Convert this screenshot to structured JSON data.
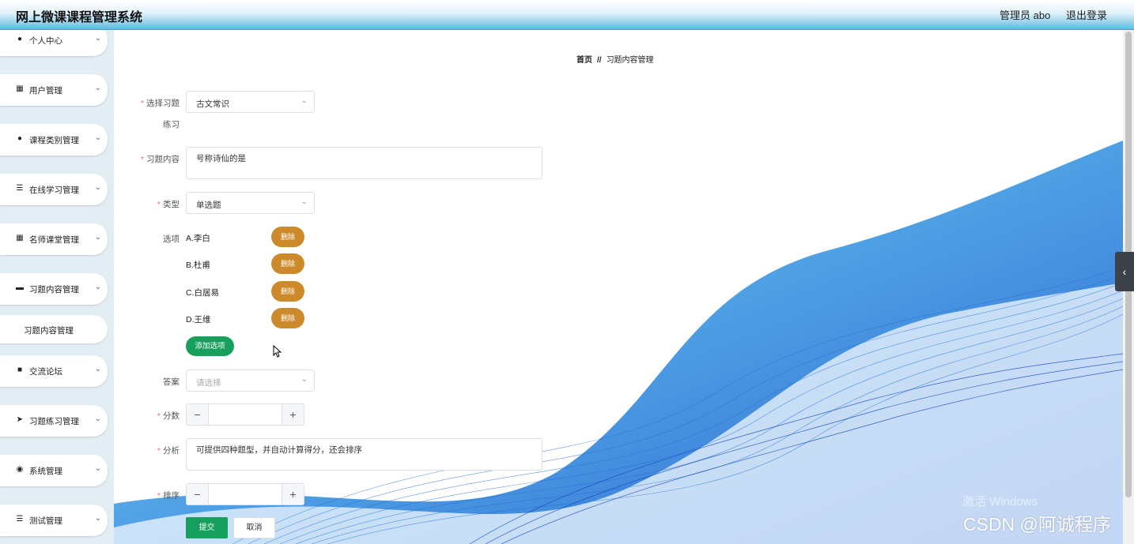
{
  "header": {
    "title": "网上微课课程管理系统",
    "user": "管理员 abo",
    "logout": "退出登录"
  },
  "sidebar": {
    "items": [
      {
        "label": "个人中心",
        "icon": "user-icon"
      },
      {
        "label": "用户管理",
        "icon": "grid-icon"
      },
      {
        "label": "课程类别管理",
        "icon": "user-icon"
      },
      {
        "label": "在线学习管理",
        "icon": "list-icon"
      },
      {
        "label": "名师课堂管理",
        "icon": "grid-icon"
      },
      {
        "label": "习题内容管理",
        "icon": "ticket-icon"
      },
      {
        "label": "交流论坛",
        "icon": "chat-icon"
      },
      {
        "label": "习题练习管理",
        "icon": "send-icon"
      },
      {
        "label": "系统管理",
        "icon": "location-icon"
      },
      {
        "label": "测试管理",
        "icon": "list-icon"
      }
    ],
    "submenu": {
      "label": "习题内容管理"
    }
  },
  "breadcrumb": {
    "home": "首页",
    "separator": "//",
    "current": "习题内容管理"
  },
  "form": {
    "exercise": {
      "label_line1": "选择习题",
      "label_line2": "练习",
      "value": "古文常识"
    },
    "content": {
      "label": "习题内容",
      "value": "号称诗仙的是"
    },
    "type": {
      "label": "类型",
      "value": "单选题"
    },
    "options": {
      "label": "选项",
      "items": [
        "A.李白",
        "B.杜甫",
        "C.白居易",
        "D.王维"
      ],
      "delete_label": "删除",
      "add_label": "添加选项"
    },
    "answer": {
      "label": "答案",
      "placeholder": "请选择"
    },
    "score": {
      "label": "分数",
      "minus": "−",
      "plus": "+"
    },
    "analysis": {
      "label": "分析",
      "value": "可提供四种题型，并自动计算得分，还会排序"
    },
    "sort": {
      "label": "排序",
      "minus": "−",
      "plus": "+"
    },
    "submit": "提交",
    "cancel": "取消"
  },
  "watermarks": {
    "windows": "激活 Windows",
    "csdn": "CSDN @阿诚程序"
  },
  "colors": {
    "delete_button": "#cd8a2a",
    "primary_green": "#17a05d",
    "header_blue": "#5fb9e0",
    "required_star": "#f56c6c"
  }
}
